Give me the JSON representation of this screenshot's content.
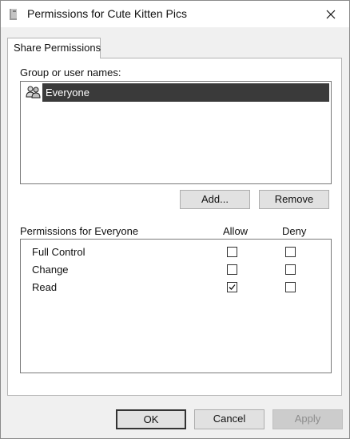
{
  "window": {
    "title": "Permissions for Cute Kitten Pics",
    "icon": "folder-share-icon",
    "close_glyph": "✕"
  },
  "tabs": [
    {
      "label": "Share Permissions",
      "selected": true
    }
  ],
  "group_users": {
    "label": "Group or user names:",
    "items": [
      {
        "name": "Everyone",
        "icon": "users-group-icon",
        "selected": true
      }
    ]
  },
  "user_buttons": {
    "add_label": "Add...",
    "remove_label": "Remove"
  },
  "permissions": {
    "header": "Permissions for Everyone",
    "allow_header": "Allow",
    "deny_header": "Deny",
    "rows": [
      {
        "name": "Full Control",
        "allow": false,
        "deny": false
      },
      {
        "name": "Change",
        "allow": false,
        "deny": false
      },
      {
        "name": "Read",
        "allow": true,
        "deny": false
      }
    ]
  },
  "footer": {
    "ok_label": "OK",
    "cancel_label": "Cancel",
    "apply_label": "Apply",
    "apply_enabled": false
  },
  "colors": {
    "selection_bg": "#3a3a3a",
    "selection_text": "#ffffff",
    "dialog_bg": "#f0f0f0",
    "disabled_text": "#8d8d8d"
  }
}
